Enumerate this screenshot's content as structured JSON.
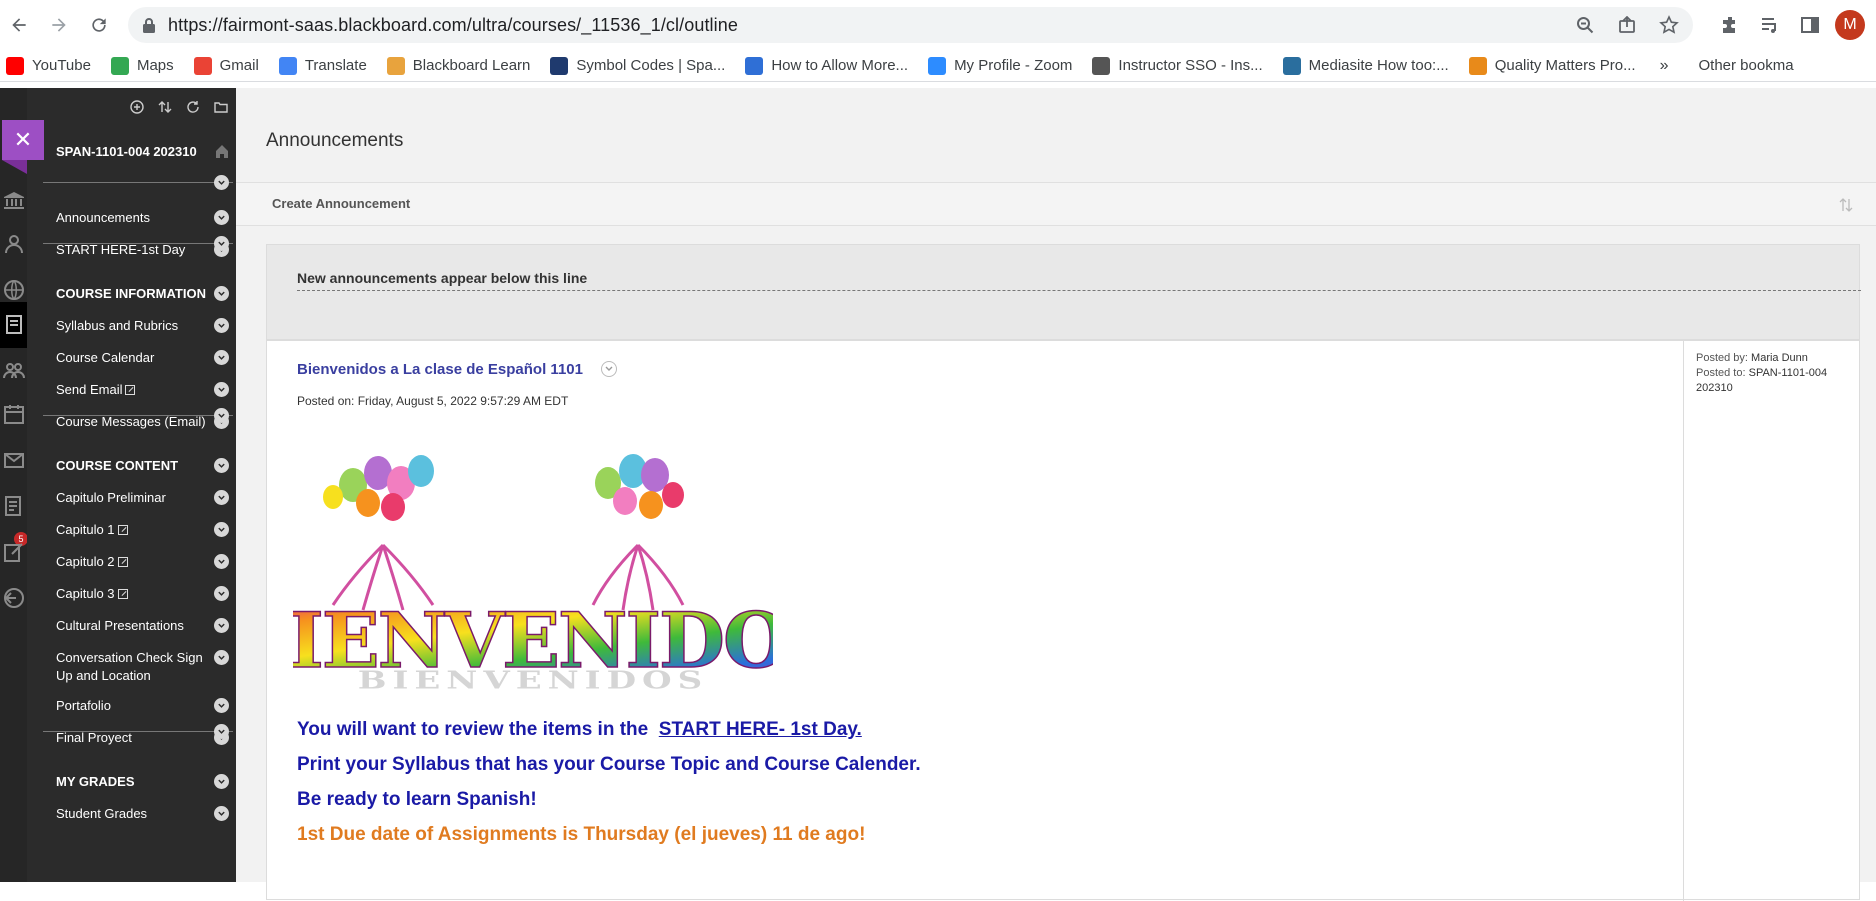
{
  "browser": {
    "url": "https://fairmont-saas.blackboard.com/ultra/courses/_11536_1/cl/outline",
    "avatar_letter": "M",
    "bookmarks": [
      {
        "label": "YouTube",
        "color": "#ff0000",
        "icon": "youtube-icon"
      },
      {
        "label": "Maps",
        "color": "#34a853",
        "icon": "maps-icon"
      },
      {
        "label": "Gmail",
        "color": "#ea4335",
        "icon": "gmail-icon"
      },
      {
        "label": "Translate",
        "color": "#4285f4",
        "icon": "translate-icon"
      },
      {
        "label": "Blackboard Learn",
        "color": "#e8a33d",
        "icon": "blackboard-icon"
      },
      {
        "label": "Symbol Codes | Spa...",
        "color": "#1f3a6e",
        "icon": "symbol-codes-icon"
      },
      {
        "label": "How to Allow More...",
        "color": "#2f6fd6",
        "icon": "jira-icon"
      },
      {
        "label": "My Profile - Zoom",
        "color": "#2d8cff",
        "icon": "zoom-icon"
      },
      {
        "label": "Instructor SSO - Ins...",
        "color": "#555555",
        "icon": "globe-icon"
      },
      {
        "label": "Mediasite How too:...",
        "color": "#2a6e9e",
        "icon": "mediasite-icon"
      },
      {
        "label": "Quality Matters Pro...",
        "color": "#e88a1a",
        "icon": "quality-matters-icon"
      }
    ],
    "bookmarks_more": "»",
    "other_bookmarks": "Other bookma"
  },
  "rail": {
    "messages_badge": "5"
  },
  "course_menu": {
    "course_title": "SPAN-1101-004 202310",
    "items": [
      {
        "label": "Announcements",
        "head": false,
        "external": false
      },
      {
        "label": "START HERE-1st Day",
        "head": false,
        "external": false
      },
      {
        "label": "COURSE INFORMATION",
        "head": true,
        "external": false
      },
      {
        "label": "Syllabus and Rubrics",
        "head": false,
        "external": false
      },
      {
        "label": "Course Calendar",
        "head": false,
        "external": false
      },
      {
        "label": "Send Email",
        "head": false,
        "external": true
      },
      {
        "label": "Course Messages (Email)",
        "head": false,
        "external": false
      },
      {
        "label": "COURSE CONTENT",
        "head": true,
        "external": false
      },
      {
        "label": "Capitulo Preliminar",
        "head": false,
        "external": false
      },
      {
        "label": "Capitulo 1",
        "head": false,
        "external": true
      },
      {
        "label": "Capitulo 2",
        "head": false,
        "external": true
      },
      {
        "label": "Capitulo 3",
        "head": false,
        "external": true
      },
      {
        "label": "Cultural Presentations",
        "head": false,
        "external": false
      },
      {
        "label": "Conversation Check Sign Up and Location",
        "head": false,
        "external": false
      },
      {
        "label": "Portafolio",
        "head": false,
        "external": false
      },
      {
        "label": "Final Proyect",
        "head": false,
        "external": false
      },
      {
        "label": "MY GRADES",
        "head": true,
        "external": false
      },
      {
        "label": "Student Grades",
        "head": false,
        "external": false
      }
    ]
  },
  "main": {
    "title": "Announcements",
    "create_label": "Create Announcement",
    "notice": "New announcements appear below this line",
    "announcement": {
      "title": "Bienvenidos a La clase de Español 1101",
      "posted_on": "Posted on: Friday, August 5, 2022 9:57:29 AM EDT",
      "posted_by_label": "Posted by:",
      "posted_by": "Maria Dunn",
      "posted_to_label": "Posted to:",
      "posted_to": "SPAN-1101-004 202310",
      "image_text": "BIENVENIDOS",
      "line1_prefix": "You will want to review the items in the",
      "line1_link": "START HERE- 1st Day.",
      "line2": "Print your Syllabus that has your Course Topic and Course Calender.",
      "line3": "Be ready to learn Spanish!",
      "line4": "1st Due date of Assignments is Thursday (el jueves) 11 de ago!",
      "accent_blue": "#1a1aa6",
      "accent_orange": "#e07b20"
    }
  }
}
